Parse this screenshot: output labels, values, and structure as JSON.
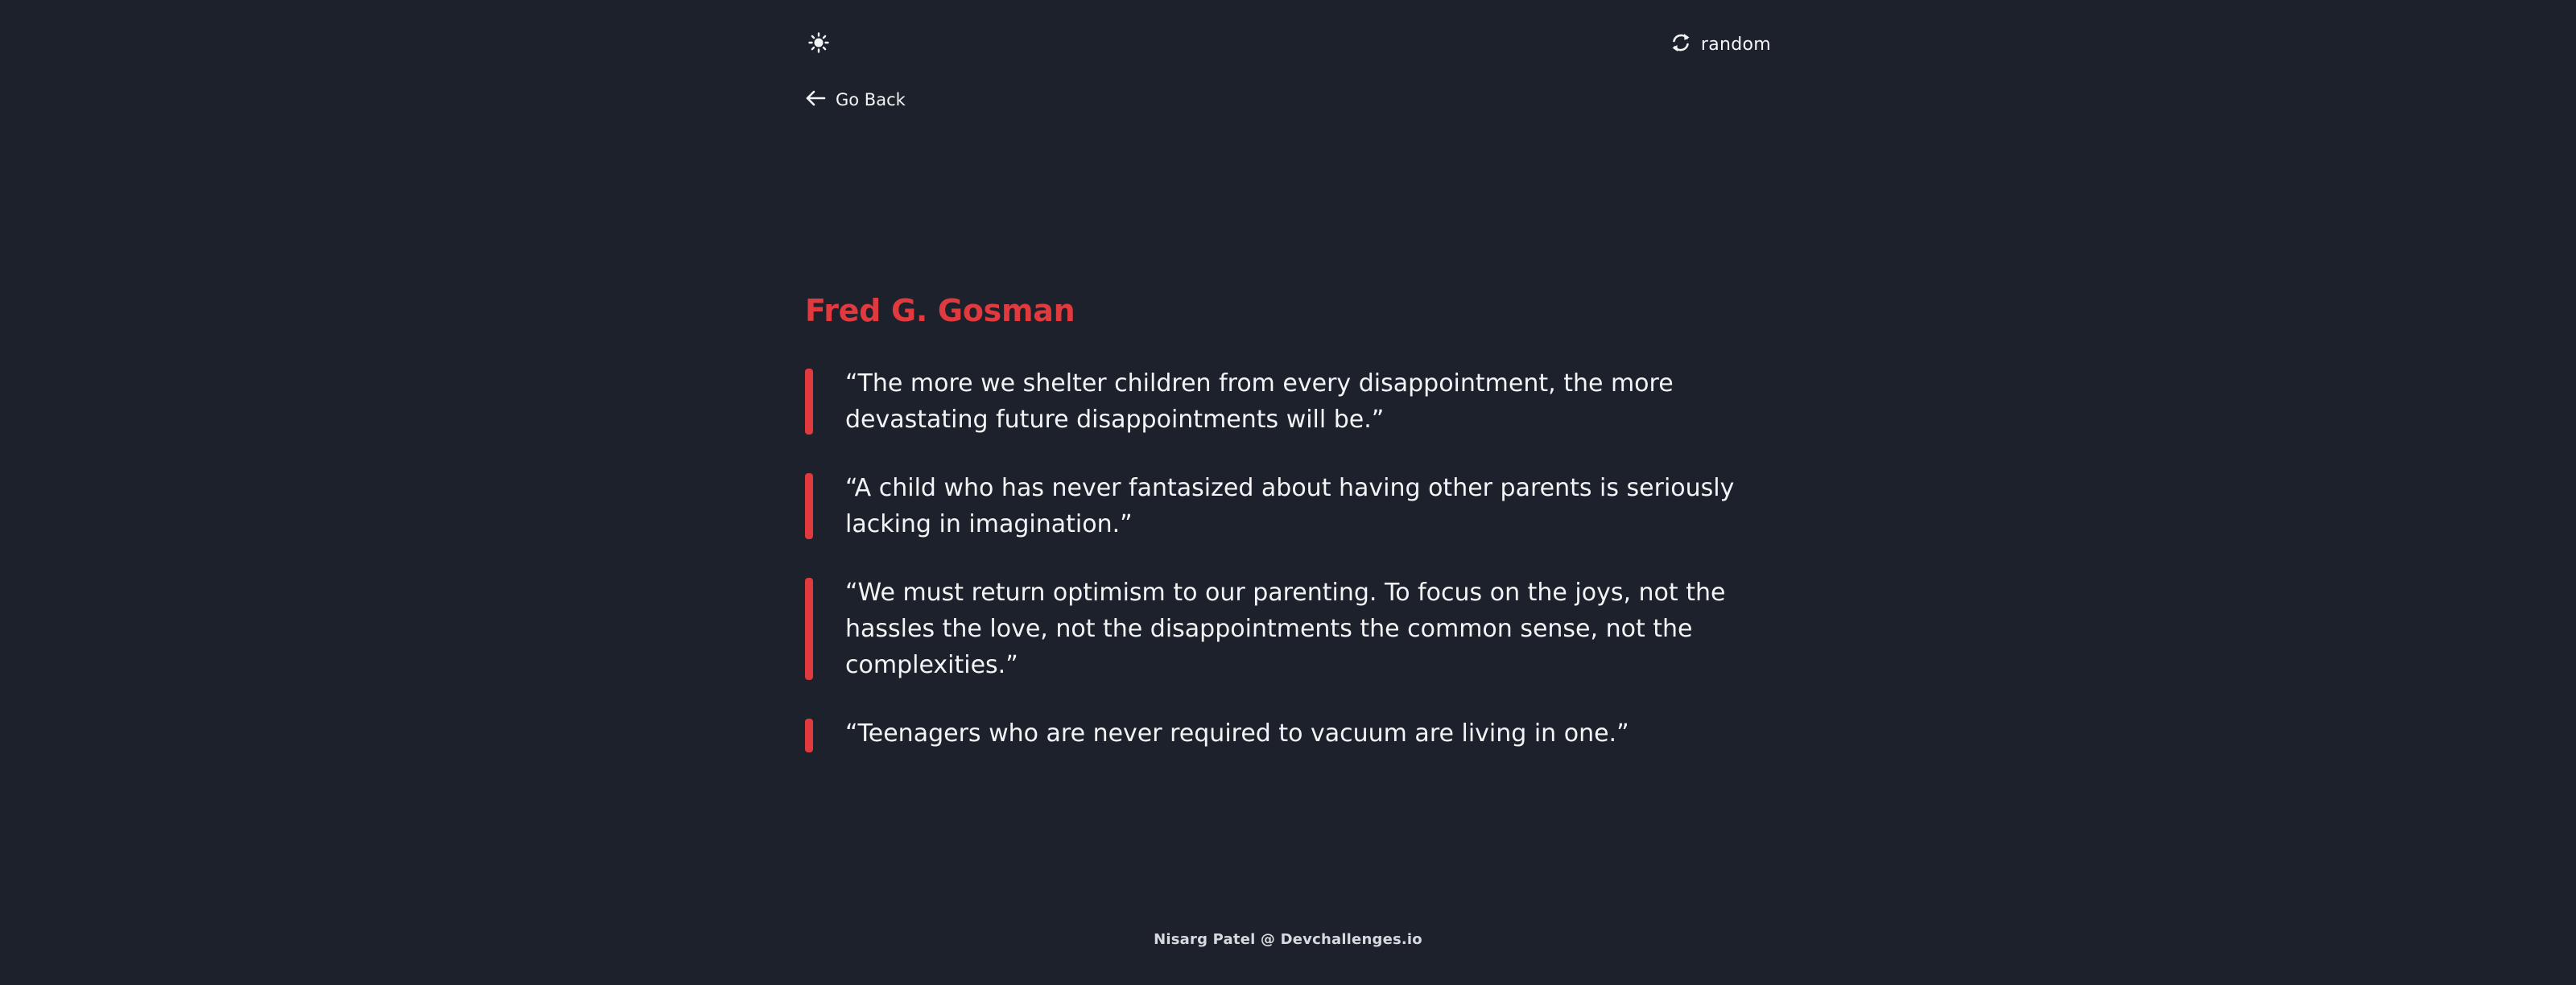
{
  "header": {
    "theme_icon": "sun-icon",
    "random": {
      "icon": "refresh-icon",
      "label": "random"
    }
  },
  "nav": {
    "back": {
      "icon": "arrow-left-icon",
      "label": "Go Back"
    }
  },
  "author": {
    "name": "Fred G. Gosman"
  },
  "quotes": [
    {
      "text": "“The more we shelter children from every disappointment, the more devastating future disappointments will be.”"
    },
    {
      "text": "“A child who has never fantasized about having other parents is seriously lacking in imagination.”"
    },
    {
      "text": "“We must return optimism to our parenting. To focus on the joys, not the hassles the love, not the disappointments the common sense, not the complexities.”"
    },
    {
      "text": "“Teenagers who are never required to vacuum are living in one.”"
    }
  ],
  "footer": {
    "credit": "Nisarg Patel @ Devchallenges.io"
  },
  "colors": {
    "background": "#1c212c",
    "accent": "#e0393e",
    "text": "#f3f4f6"
  }
}
